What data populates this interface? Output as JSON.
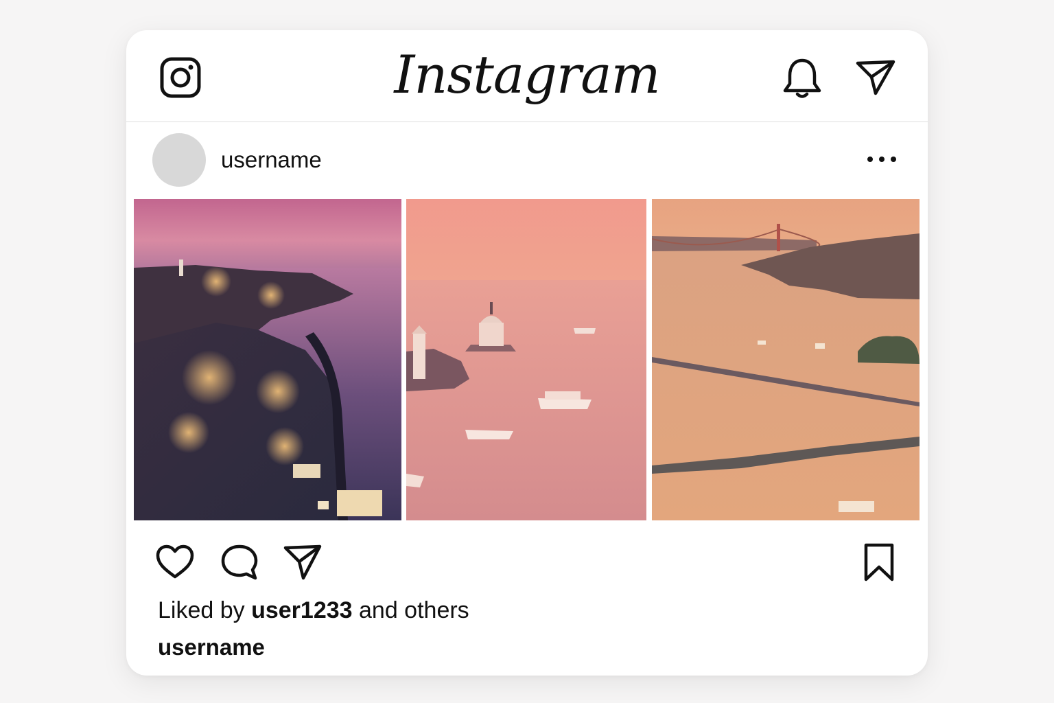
{
  "app": {
    "title": "Instagram"
  },
  "header": {
    "icons": [
      "instagram-logo-icon",
      "bell-icon",
      "direct-message-icon"
    ]
  },
  "post": {
    "username": "username",
    "more_icon": "more-dots-icon",
    "images": [
      {
        "description_icon": "istanbul-waterfront-photo"
      },
      {
        "description_icon": "maidens-tower-photo"
      },
      {
        "description_icon": "bosphorus-bridge-photo"
      }
    ],
    "actions": [
      "heart-icon",
      "comment-icon",
      "share-icon",
      "bookmark-icon"
    ],
    "likes": {
      "prefix": "Liked by ",
      "user": "user1233",
      "suffix": " and others"
    },
    "caption_username": "username"
  },
  "colors": {
    "background": "#f6f5f5",
    "card": "#ffffff",
    "text": "#111111",
    "avatar": "#d8d8d8"
  }
}
